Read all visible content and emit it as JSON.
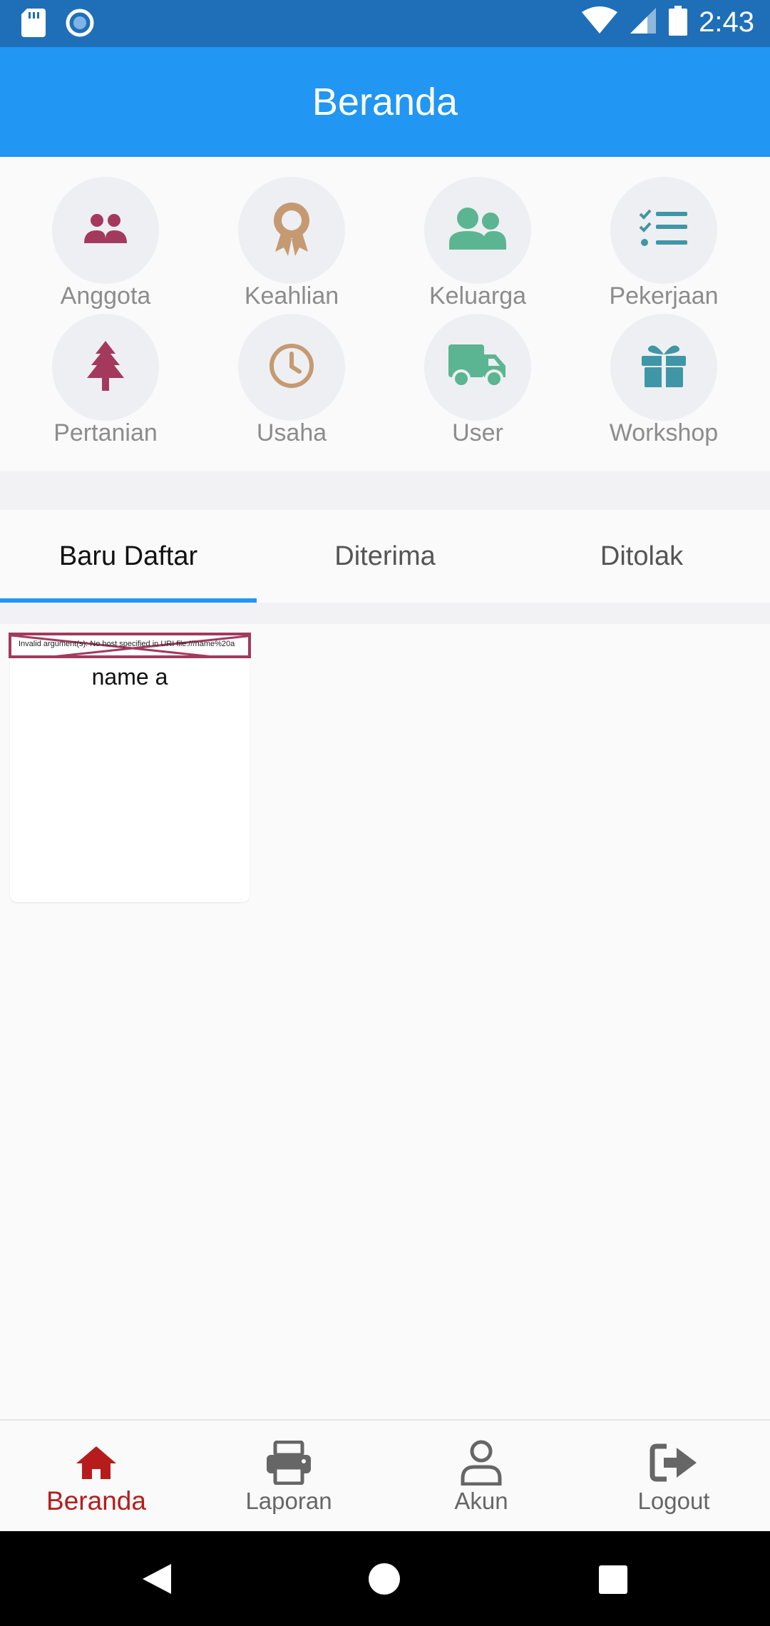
{
  "status_bar": {
    "time": "2:43"
  },
  "app_bar": {
    "title": "Beranda"
  },
  "menu": {
    "items": [
      {
        "label": "Anggota",
        "icon": "people-icon",
        "color": "#a33a5e"
      },
      {
        "label": "Keahlian",
        "icon": "award-icon",
        "color": "#c59a72"
      },
      {
        "label": "Keluarga",
        "icon": "family-icon",
        "color": "#5bb592"
      },
      {
        "label": "Pekerjaan",
        "icon": "tasks-icon",
        "color": "#3f96a6"
      },
      {
        "label": "Pertanian",
        "icon": "tree-icon",
        "color": "#a33a5e"
      },
      {
        "label": "Usaha",
        "icon": "clock-icon",
        "color": "#c59a72"
      },
      {
        "label": "User",
        "icon": "truck-icon",
        "color": "#5bb592"
      },
      {
        "label": "Workshop",
        "icon": "gift-icon",
        "color": "#3f96a6"
      }
    ]
  },
  "tabs": [
    {
      "label": "Baru Daftar",
      "active": true
    },
    {
      "label": "Diterima",
      "active": false
    },
    {
      "label": "Ditolak",
      "active": false
    }
  ],
  "cards": [
    {
      "error_text": "Invalid argument(s): No host specified in URI file:///name%20a",
      "name": "name a"
    }
  ],
  "bottom_nav": {
    "items": [
      {
        "label": "Beranda",
        "icon": "home-icon",
        "active": true
      },
      {
        "label": "Laporan",
        "icon": "printer-icon",
        "active": false
      },
      {
        "label": "Akun",
        "icon": "user-icon",
        "active": false
      },
      {
        "label": "Logout",
        "icon": "logout-icon",
        "active": false
      }
    ]
  },
  "colors": {
    "app_bar": "#2196f3",
    "status_bar": "#1f6fb8",
    "active_nav": "#b71c1c",
    "tab_indicator": "#2196f3"
  }
}
